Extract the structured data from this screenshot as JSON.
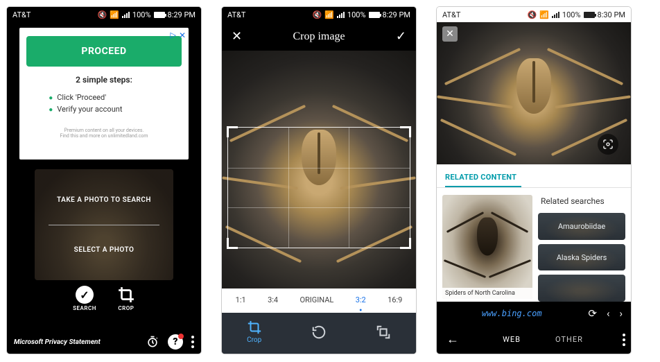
{
  "status": {
    "carrier": "AT&T",
    "battery_pct": "100%",
    "time_a": "8:29 PM",
    "time_b": "8:29 PM",
    "time_c": "8:30 PM"
  },
  "screen1": {
    "ad": {
      "close_icon": "▷",
      "x_icon": "✕",
      "proceed": "PROCEED",
      "steps_heading": "2 simple steps:",
      "step1": "Click 'Proceed'",
      "step2": "Verify your account",
      "fine1": "Premium content on all your devices.",
      "fine2": "Find this and more on unlimitedland.com"
    },
    "panel": {
      "take": "TAKE A PHOTO TO SEARCH",
      "select": "SELECT A PHOTO"
    },
    "toolbar": {
      "search": "SEARCH",
      "crop": "CROP"
    },
    "footer": {
      "privacy": "Microsoft Privacy Statement"
    }
  },
  "screen2": {
    "title": "Crop image",
    "ratios": {
      "r1": "1:1",
      "r2": "3:4",
      "r3": "ORIGINAL",
      "r4": "3:2",
      "r5": "16:9",
      "selected": "3:2"
    },
    "footer": {
      "crop": "Crop"
    }
  },
  "screen3": {
    "section": "RELATED CONTENT",
    "thumb_caption": "Spiders of North Carolina",
    "side_title": "Related searches",
    "chips": {
      "a": "Amaurobiidae",
      "b": "Alaska Spiders"
    },
    "url": "www.bing.com",
    "tabs": {
      "web": "WEB",
      "other": "OTHER"
    }
  }
}
